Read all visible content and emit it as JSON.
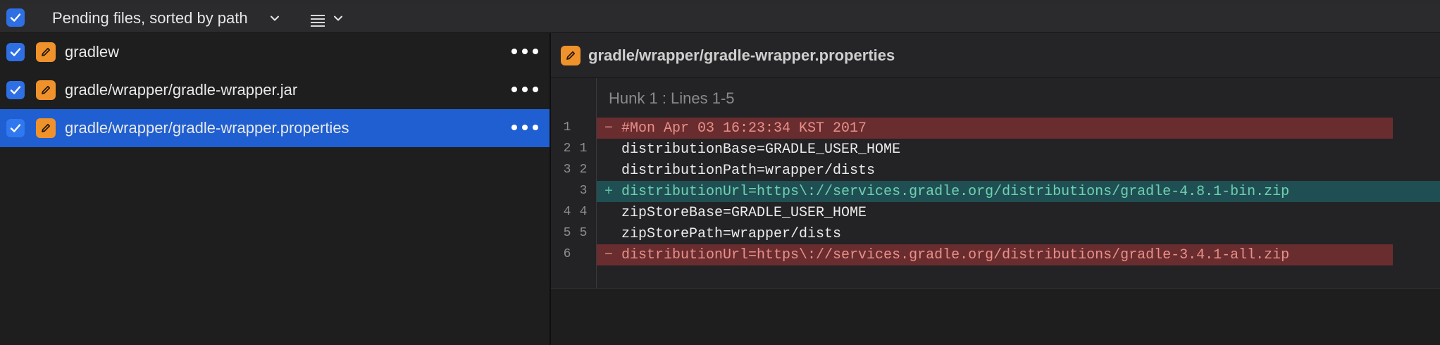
{
  "toolbar": {
    "sort_label": "Pending files, sorted by path",
    "select_all_checked": true,
    "icons": [
      "checkmark-icon",
      "chevron-down-icon",
      "list-view-icon",
      "chevron-down-icon"
    ]
  },
  "files": [
    {
      "name": "gradlew",
      "checked": true,
      "selected": false,
      "status_icon": "pencil-icon"
    },
    {
      "name": "gradle/wrapper/gradle-wrapper.jar",
      "checked": true,
      "selected": false,
      "status_icon": "pencil-icon"
    },
    {
      "name": "gradle/wrapper/gradle-wrapper.properties",
      "checked": true,
      "selected": true,
      "status_icon": "pencil-icon"
    }
  ],
  "diff": {
    "title": "gradle/wrapper/gradle-wrapper.properties",
    "hunk_title": "Hunk 1 : Lines 1-5",
    "lines": [
      {
        "type": "removed",
        "old": "1",
        "new": "",
        "marker": "−",
        "text": "#Mon Apr 03 16:23:34 KST 2017"
      },
      {
        "type": "context",
        "old": "2",
        "new": "1",
        "marker": "",
        "text": "distributionBase=GRADLE_USER_HOME"
      },
      {
        "type": "context",
        "old": "3",
        "new": "2",
        "marker": "",
        "text": "distributionPath=wrapper/dists"
      },
      {
        "type": "added",
        "old": "",
        "new": "3",
        "marker": "+",
        "text": "distributionUrl=https\\://services.gradle.org/distributions/gradle-4.8.1-bin.zip"
      },
      {
        "type": "context",
        "old": "4",
        "new": "4",
        "marker": "",
        "text": "zipStoreBase=GRADLE_USER_HOME"
      },
      {
        "type": "context",
        "old": "5",
        "new": "5",
        "marker": "",
        "text": "zipStorePath=wrapper/dists"
      },
      {
        "type": "removed",
        "old": "6",
        "new": "",
        "marker": "−",
        "text": "distributionUrl=https\\://services.gradle.org/distributions/gradle-3.4.1-all.zip"
      }
    ]
  },
  "colors": {
    "accent": "#2f6fe4",
    "selection": "#1f5fd1",
    "modified_badge": "#f0922b",
    "removed_bg": "#6a2d2f",
    "added_bg": "#1f4f53"
  }
}
